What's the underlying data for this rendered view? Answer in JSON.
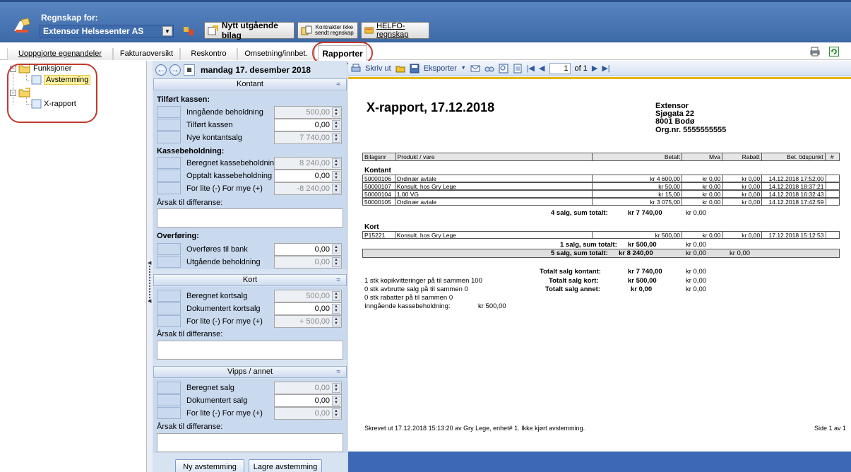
{
  "header": {
    "regnskap_label": "Regnskap for:",
    "company": "Extensor Helsesenter AS",
    "new_voucher_btn": "Nytt utgående bilag",
    "contracts_btn_line1": "Kontrakter ikke",
    "contracts_btn_line2": "sendt regnskap",
    "helfo_btn": "HELFO-regnskap"
  },
  "tabs": [
    {
      "label": "Uoppgjorte egenandeler"
    },
    {
      "label": "Fakturaoversikt"
    },
    {
      "label": "Reskontro"
    },
    {
      "label": "Omsetning/innbet."
    },
    {
      "label": "Rapporter"
    }
  ],
  "tree": {
    "funksjoner": "Funksjoner",
    "avstemming": "Avstemming",
    "xrapport": "X-rapport"
  },
  "datebar": {
    "date": "mandag 17. desember 2018"
  },
  "kontant": {
    "title": "Kontant",
    "tilfort_group": "Tilført kassen:",
    "inngaende_label": "Inngående beholdning",
    "inngaende_value": "500,00",
    "tilfort_label": "Tilført kassen",
    "tilfort_value": "0,00",
    "nye_label": "Nye kontantsalg",
    "nye_value": "7 740,00",
    "kasse_group": "Kassebeholdning:",
    "beregnet_label": "Beregnet kassebeholdning",
    "beregnet_value": "8 240,00",
    "opptalt_label": "Opptalt kassebeholdning",
    "opptalt_value": "0,00",
    "forlite_label": "For lite (-) For mye (+)",
    "forlite_value": "-8 240,00",
    "arsak_label": "Årsak til differanse:",
    "overforing_group": "Overføring:",
    "bank_label": "Overføres til bank",
    "bank_value": "0,00",
    "utgaende_label": "Utgående beholdning",
    "utgaende_value": "0,00"
  },
  "kort": {
    "title": "Kort",
    "beregnet_label": "Beregnet kortsalg",
    "beregnet_value": "500,00",
    "dok_label": "Dokumentert kortsalg",
    "dok_value": "0,00",
    "forlite_label": "For lite (-) For mye (+)",
    "forlite_value": "+ 500,00",
    "arsak_label": "Årsak til differanse:"
  },
  "vipps": {
    "title": "Vipps / annet",
    "beregnet_label": "Beregnet salg",
    "beregnet_value": "0,00",
    "dok_label": "Dokumentert salg",
    "dok_value": "0,00",
    "forlite_label": "For lite (-) For mye (+)",
    "forlite_value": "0,00",
    "arsak_label": "Årsak til differanse:"
  },
  "buttons": {
    "ny": "Ny avstemming",
    "lagre": "Lagre avstemming"
  },
  "report_toolbar": {
    "print": "Skriv ut",
    "export": "Eksporter",
    "page": "1",
    "of": "of 1"
  },
  "report": {
    "title": "X-rapport, 17.12.2018",
    "addr1": "Extensor",
    "addr2": "Sjøgata 22",
    "addr3": "8001 Bodø",
    "addr4": "Org.nr. 5555555555",
    "headers": [
      "Bilagsnr",
      "Produkt / vare",
      "Betalt",
      "Mva",
      "Rabatt",
      "Bet. tidspunkt",
      "#"
    ],
    "kontant_title": "Kontant",
    "kontant_rows": [
      [
        "50000106",
        "Ordinær avtale",
        "kr 4 600,00",
        "kr 0,00",
        "kr 0,00",
        "14.12.2018 17:52:00",
        ""
      ],
      [
        "50000107",
        "Konsult. hos Gry Lege",
        "kr 50,00",
        "kr 0,00",
        "kr 0,00",
        "14.12.2018 18:37:21",
        ""
      ],
      [
        "50000104",
        "1.00 VG",
        "kr 15,00",
        "kr 0,00",
        "kr 0,00",
        "14.12.2018 16:32:43",
        ""
      ],
      [
        "50000105",
        "Ordinær avtale",
        "kr 3 075,00",
        "kr 0,00",
        "kr 0,00",
        "14.12.2018 17:42:59",
        ""
      ]
    ],
    "kontant_sum_label": "4 salg, sum totalt:",
    "kontant_sum_value": "kr 7 740,00",
    "kontant_sum_mva": "kr 0,00",
    "kort_title": "Kort",
    "kort_rows": [
      [
        "P15221",
        "Konsult. hos Gry Lege",
        "kr 500,00",
        "kr 0,00",
        "kr 0,00",
        "17.12.2018 15:12:53",
        ""
      ]
    ],
    "kort_sum_label": "1 salg, sum totalt:",
    "kort_sum_value": "kr 500,00",
    "kort_sum_mva": "kr 0,00",
    "total_label": "5 salg, sum totalt:",
    "total_value": "kr 8 240,00",
    "total_mva": "kr 0,00",
    "total_rabatt": "kr 0,00",
    "tot_kontant_label": "Totalt salg kontant:",
    "tot_kontant_value": "kr 7 740,00",
    "tot_kontant_mva": "kr 0,00",
    "tot_kort_label": "Totalt salg kort:",
    "tot_kort_value": "kr 500,00",
    "tot_kort_mva": "kr 0,00",
    "tot_annet_label": "Totalt salg annet:",
    "tot_annet_value": "kr 0,00",
    "tot_annet_mva": "kr 0,00",
    "note1": "1 stk kopikvitteringer på til sammen 100",
    "note2": "0 stk avbrutte salg på til sammen 0",
    "note3": "0 stk rabatter på til sammen 0",
    "note4_label": "Inngående kassebeholdning:",
    "note4_value": "kr 500,00",
    "footer": "Skrevet ut 17.12.2018 15:13:20 av Gry Lege, enhet# 1. Ikke kjørt avstemming.",
    "page": "Side 1 av 1"
  },
  "colors": {
    "accent_oval": "#c0392b",
    "topbar": "#4a78b8",
    "panel": "#c9d9ee"
  }
}
